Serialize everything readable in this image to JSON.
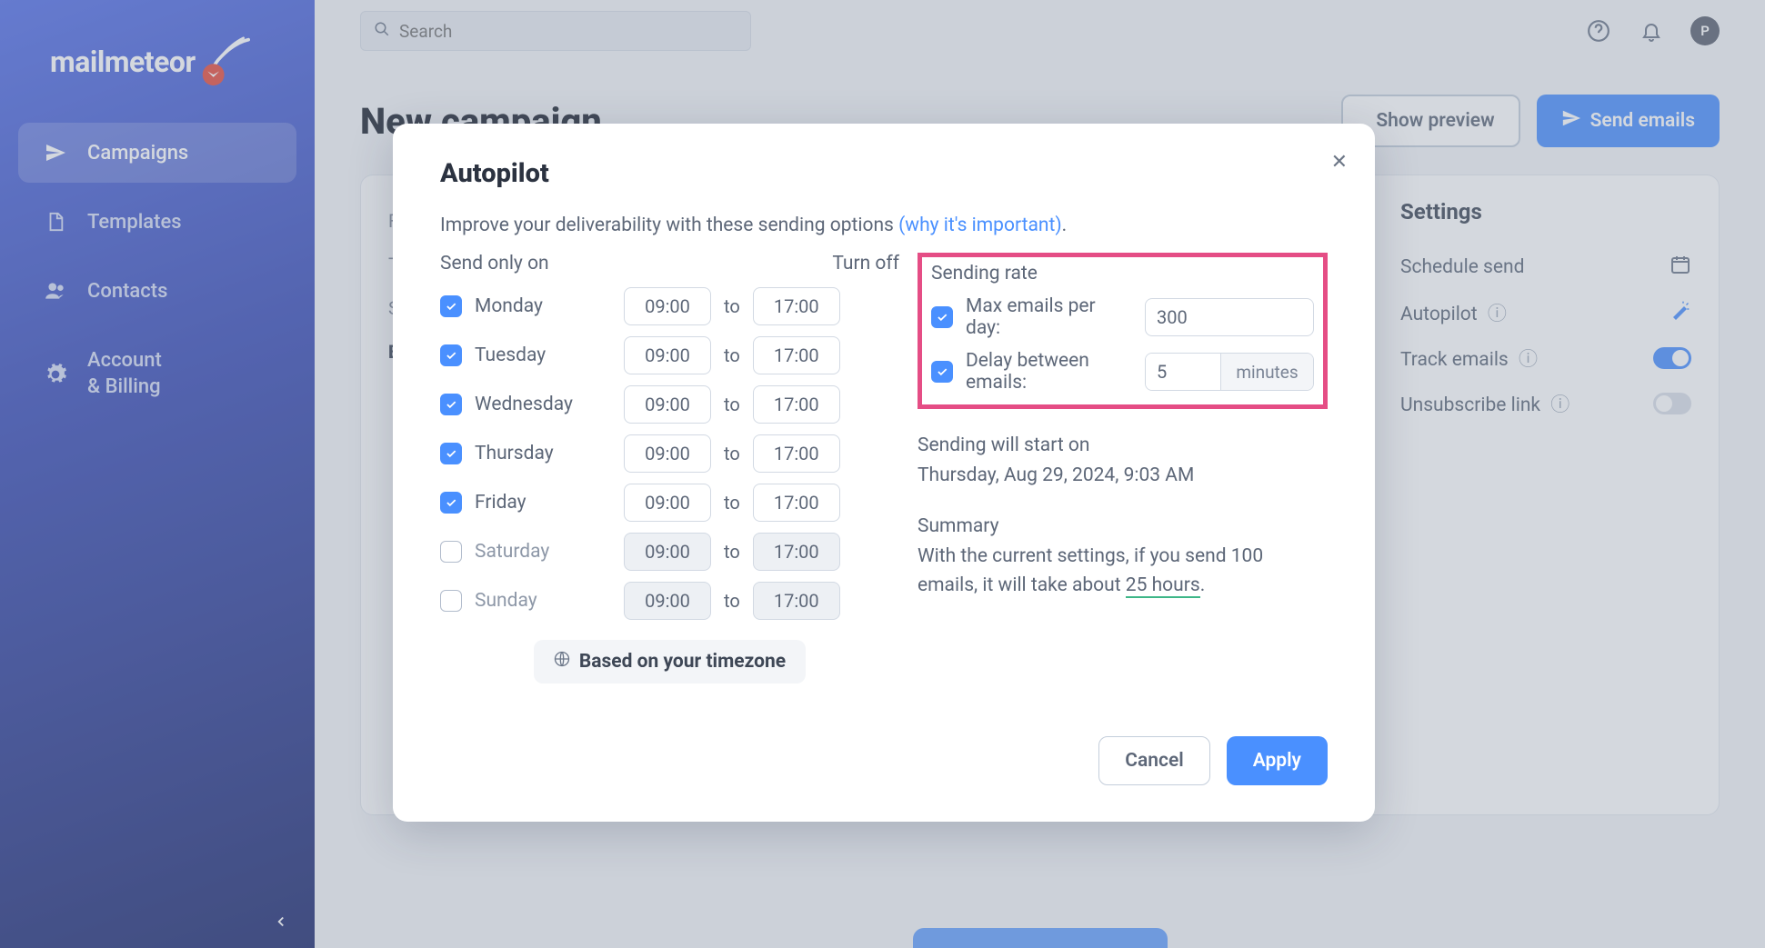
{
  "brand": {
    "name": "mailmeteor"
  },
  "nav": {
    "items": [
      {
        "label": "Campaigns",
        "icon": "send"
      },
      {
        "label": "Templates",
        "icon": "file"
      },
      {
        "label": "Contacts",
        "icon": "people"
      },
      {
        "label": "Account",
        "label2": "& Billing",
        "icon": "gear"
      }
    ]
  },
  "search": {
    "placeholder": "Search"
  },
  "user": {
    "avatar_initial": "P"
  },
  "page": {
    "title": "New campaign",
    "show_preview": "Show preview",
    "send_emails": "Send emails",
    "stubs": {
      "a": "Fr",
      "b": "Tc",
      "c": "S",
      "d": "B"
    }
  },
  "settings": {
    "title": "Settings",
    "schedule": "Schedule send",
    "autopilot": "Autopilot",
    "track": "Track emails",
    "unsub": "Unsubscribe link"
  },
  "modal": {
    "title": "Autopilot",
    "desc_prefix": "Improve your deliverability with these sending options ",
    "desc_link": "(why it's important)",
    "desc_suffix": ".",
    "send_only_on": "Send only on",
    "turn_off": "Turn off",
    "to": "to",
    "days": [
      {
        "name": "Monday",
        "checked": true,
        "from": "09:00",
        "to": "17:00"
      },
      {
        "name": "Tuesday",
        "checked": true,
        "from": "09:00",
        "to": "17:00"
      },
      {
        "name": "Wednesday",
        "checked": true,
        "from": "09:00",
        "to": "17:00"
      },
      {
        "name": "Thursday",
        "checked": true,
        "from": "09:00",
        "to": "17:00"
      },
      {
        "name": "Friday",
        "checked": true,
        "from": "09:00",
        "to": "17:00"
      },
      {
        "name": "Saturday",
        "checked": false,
        "from": "09:00",
        "to": "17:00"
      },
      {
        "name": "Sunday",
        "checked": false,
        "from": "09:00",
        "to": "17:00"
      }
    ],
    "timezone": "Based on your timezone",
    "rate": {
      "title": "Sending rate",
      "max_label": "Max emails per day:",
      "max_value": "300",
      "delay_label": "Delay between emails:",
      "delay_value": "5",
      "delay_unit": "minutes"
    },
    "start_label": "Sending will start on",
    "start_value": "Thursday, Aug 29, 2024, 9:03 AM",
    "summary_label": "Summary",
    "summary_text_a": "With the current settings, if you send 100 emails, it will take about ",
    "summary_hours": "25 hours",
    "summary_text_b": ".",
    "cancel": "Cancel",
    "apply": "Apply"
  }
}
